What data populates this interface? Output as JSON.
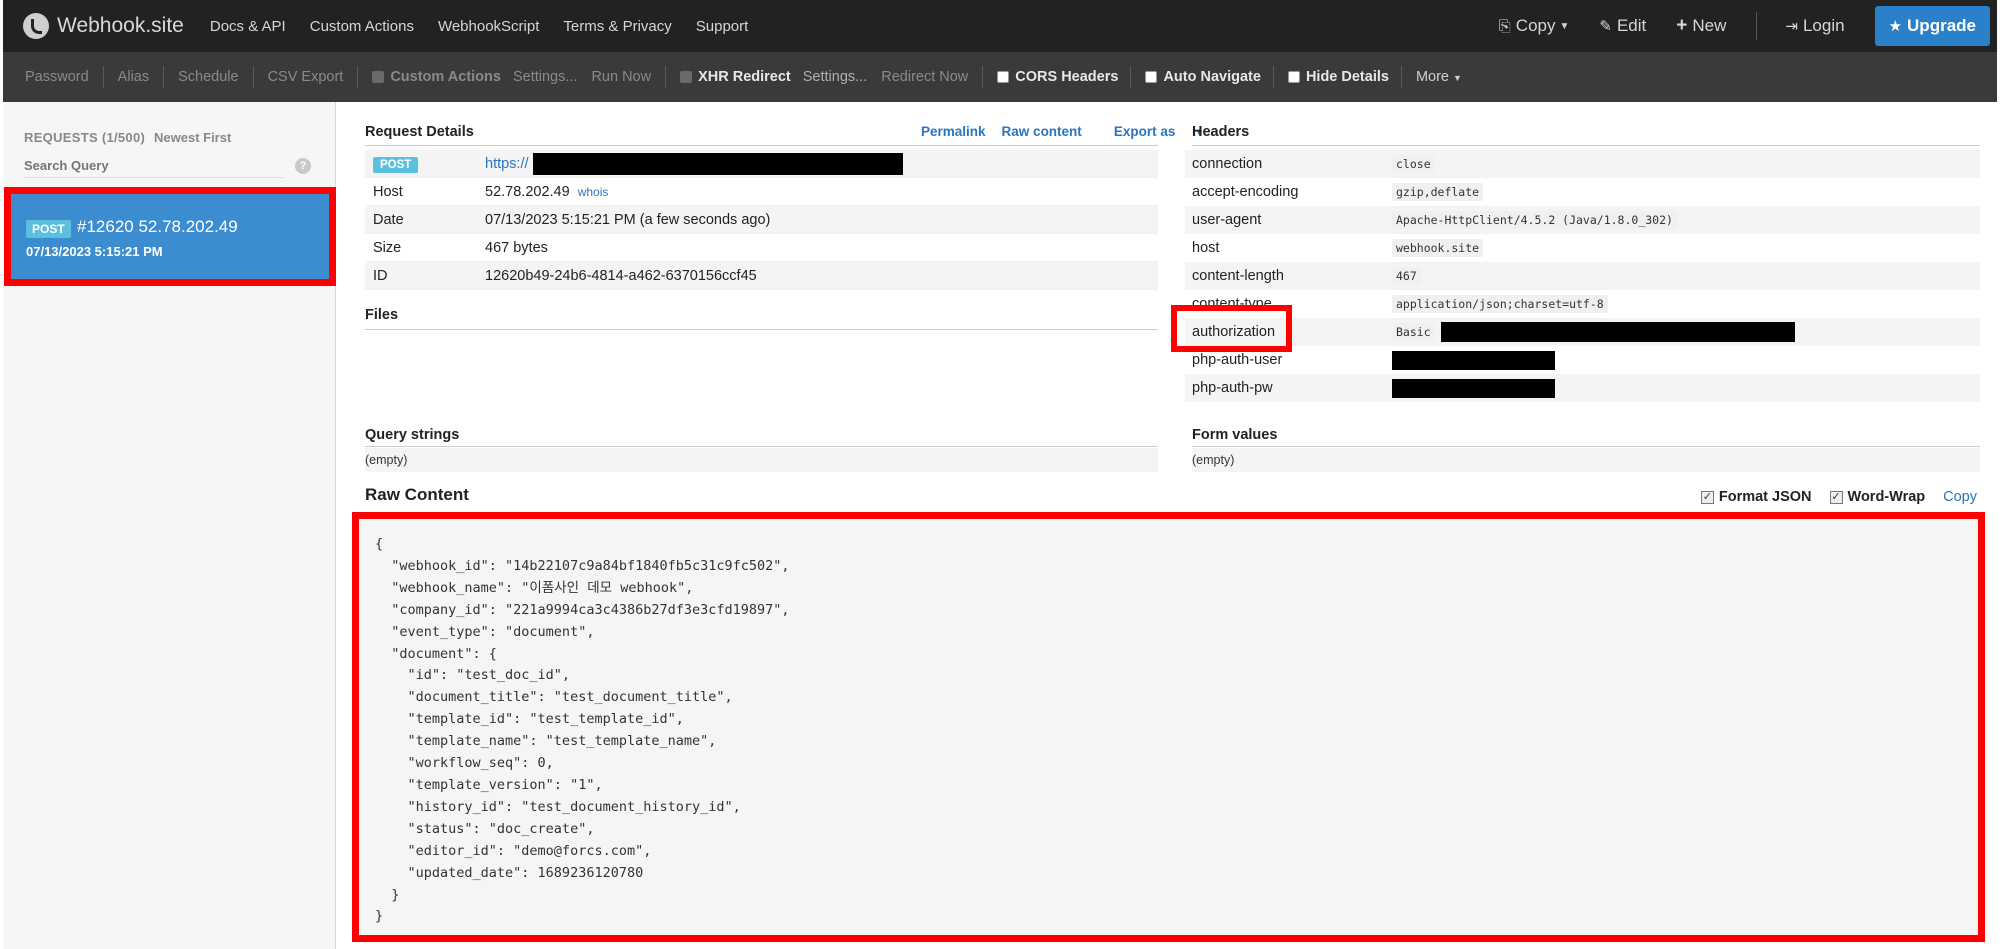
{
  "navbar": {
    "brand": "Webhook.site",
    "links": [
      "Docs & API",
      "Custom Actions",
      "WebhookScript",
      "Terms & Privacy",
      "Support"
    ],
    "copy": "Copy",
    "edit": "Edit",
    "new": "New",
    "login": "Login",
    "upgrade": "Upgrade"
  },
  "toolbar": {
    "password": "Password",
    "alias": "Alias",
    "schedule": "Schedule",
    "csv_export": "CSV Export",
    "custom_actions": "Custom Actions",
    "settings1": "Settings...",
    "run_now": "Run Now",
    "xhr_redirect": "XHR Redirect",
    "settings2": "Settings...",
    "redirect_now": "Redirect Now",
    "cors_headers": "CORS Headers",
    "auto_navigate": "Auto Navigate",
    "hide_details": "Hide Details",
    "more": "More"
  },
  "sidebar": {
    "requests_label": "REQUESTS (1/500)",
    "sort": "Newest First",
    "search_placeholder": "Search Query",
    "help": "?",
    "item": {
      "method": "POST",
      "title": "#12620 52.78.202.49",
      "date": "07/13/2023 5:15:21 PM"
    }
  },
  "request_details": {
    "title": "Request Details",
    "permalink": "Permalink",
    "raw_content": "Raw content",
    "export_as": "Export as",
    "method": "POST",
    "url": "https://",
    "host_label": "Host",
    "host": "52.78.202.49",
    "whois": "whois",
    "date_label": "Date",
    "date": "07/13/2023 5:15:21 PM (a few seconds ago)",
    "size_label": "Size",
    "size": "467 bytes",
    "id_label": "ID",
    "id": "12620b49-24b6-4814-a462-6370156ccf45"
  },
  "files": {
    "title": "Files"
  },
  "headers": {
    "title": "Headers",
    "rows": [
      {
        "key": "connection",
        "value": "close"
      },
      {
        "key": "accept-encoding",
        "value": "gzip,deflate"
      },
      {
        "key": "user-agent",
        "value": "Apache-HttpClient/4.5.2 (Java/1.8.0_302)"
      },
      {
        "key": "host",
        "value": "webhook.site"
      },
      {
        "key": "content-length",
        "value": "467"
      },
      {
        "key": "content-type",
        "value": "application/json;charset=utf-8"
      },
      {
        "key": "authorization",
        "value": "Basic"
      },
      {
        "key": "php-auth-user",
        "value": ""
      },
      {
        "key": "php-auth-pw",
        "value": ""
      }
    ]
  },
  "query_strings": {
    "title": "Query strings",
    "value": "(empty)"
  },
  "form_values": {
    "title": "Form values",
    "value": "(empty)"
  },
  "raw": {
    "title": "Raw Content",
    "format_json": "Format JSON",
    "word_wrap": "Word-Wrap",
    "copy": "Copy",
    "body": "{\n  \"webhook_id\": \"14b22107c9a84bf1840fb5c31c9fc502\",\n  \"webhook_name\": \"이폼사인 데모 webhook\",\n  \"company_id\": \"221a9994ca3c4386b27df3e3cfd19897\",\n  \"event_type\": \"document\",\n  \"document\": {\n    \"id\": \"test_doc_id\",\n    \"document_title\": \"test_document_title\",\n    \"template_id\": \"test_template_id\",\n    \"template_name\": \"test_template_name\",\n    \"workflow_seq\": 0,\n    \"template_version\": \"1\",\n    \"history_id\": \"test_document_history_id\",\n    \"status\": \"doc_create\",\n    \"editor_id\": \"demo@forcs.com\",\n    \"updated_date\": 1689236120780\n  }\n}"
  }
}
